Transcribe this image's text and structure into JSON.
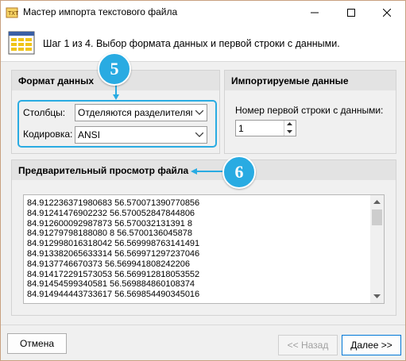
{
  "window": {
    "title": "Мастер импорта текстового файла"
  },
  "header": {
    "step_text": "Шаг 1 из 4. Выбор формата данных и первой строки с данными."
  },
  "format_group": {
    "title": "Формат данных",
    "columns_label": "Столбцы:",
    "columns_value": "Отделяются разделителями",
    "encoding_label": "Кодировка:",
    "encoding_value": "ANSI"
  },
  "import_group": {
    "title": "Импортируемые данные",
    "first_row_label": "Номер первой строки с данными:",
    "first_row_value": "1"
  },
  "preview_group": {
    "title": "Предварительный просмотр файла",
    "lines": [
      "84.912236371980683 56.570071390770856",
      "84.91241476902232 56.570052847844806",
      "84.912600092987873 56.570032131391 8",
      "84.91279798188080 8 56.5700136045878",
      "84.912998016318042 56.569998763141491",
      "84.913382065633314 56.569971297237046",
      "84.9137746670373 56.569941808242206",
      "84.914172291573053 56.569912818053552",
      "84.91454599340581 56.569884860108374",
      "84.914944443733617 56.569854490345016"
    ]
  },
  "badges": {
    "b5": "5",
    "b6": "6"
  },
  "buttons": {
    "cancel": "Отмена",
    "back": "<< Назад",
    "next": "Далее >>"
  },
  "colors": {
    "accent": "#29abe2",
    "focus_border": "#0078d7",
    "frame": "#c8a080"
  }
}
